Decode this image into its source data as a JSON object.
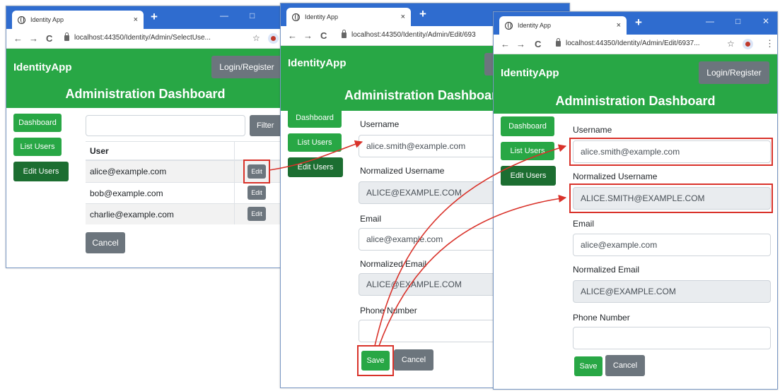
{
  "browser": {
    "tab_title": "Identity App",
    "tab_close": "×",
    "new_tab": "+",
    "url_select": "localhost:44350/Identity/Admin/SelectUse...",
    "url_edit_mid": "localhost:44350/Identity/Admin/Edit/693",
    "url_edit_front": "localhost:44350/Identity/Admin/Edit/6937...",
    "minimize": "—",
    "maximize": "□",
    "close": "✕",
    "back": "←",
    "forward": "→",
    "reload": "C",
    "star": "☆",
    "menu": "⋮"
  },
  "app": {
    "brand": "IdentityApp",
    "login": "Login/Register",
    "dashboard_title": "Administration Dashboard",
    "nav": {
      "dashboard": "Dashboard",
      "list_users": "List Users",
      "edit_users": "Edit Users"
    }
  },
  "select_page": {
    "filter_button": "Filter",
    "filter_value": "",
    "header_user": "User",
    "users": [
      "alice@example.com",
      "bob@example.com",
      "charlie@example.com"
    ],
    "edit_label": "Edit",
    "cancel": "Cancel"
  },
  "edit_mid": {
    "username_label": "Username",
    "username_value": "alice.smith@example.com",
    "norm_username_label": "Normalized Username",
    "norm_username_value": "ALICE@EXAMPLE.COM",
    "email_label": "Email",
    "email_value": "alice@example.com",
    "norm_email_label": "Normalized Email",
    "norm_email_value": "ALICE@EXAMPLE.COM",
    "phone_label": "Phone Number",
    "phone_value": "",
    "save": "Save",
    "cancel": "Cancel"
  },
  "edit_front": {
    "username_label": "Username",
    "username_value": "alice.smith@example.com",
    "norm_username_label": "Normalized Username",
    "norm_username_value": "ALICE.SMITH@EXAMPLE.COM",
    "email_label": "Email",
    "email_value": "alice@example.com",
    "norm_email_label": "Normalized Email",
    "norm_email_value": "ALICE@EXAMPLE.COM",
    "phone_label": "Phone Number",
    "phone_value": "",
    "save": "Save",
    "cancel": "Cancel"
  },
  "colors": {
    "chrome_blue": "#2f6ccf",
    "app_green": "#28a745",
    "nav_active_green": "#1c6e31",
    "button_gray": "#6c757d",
    "highlight_red": "#d9322a"
  }
}
